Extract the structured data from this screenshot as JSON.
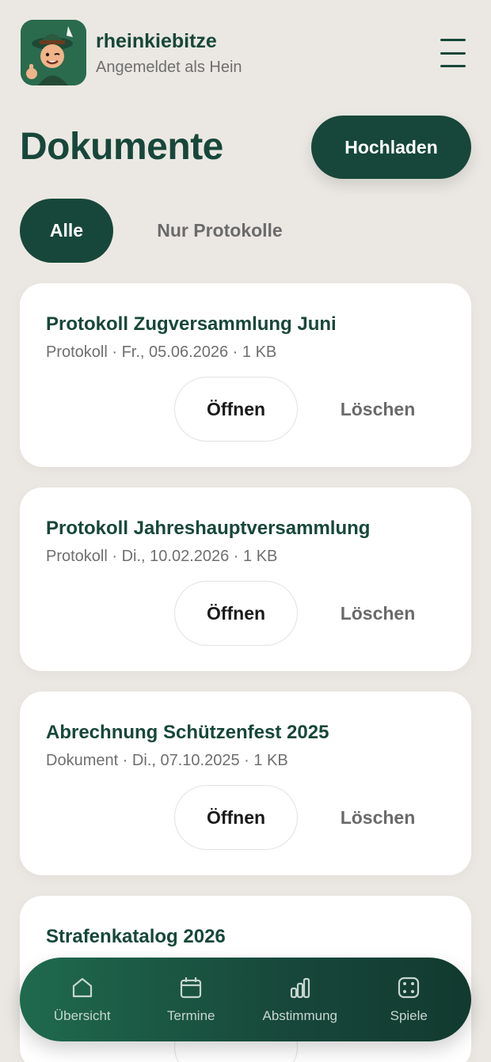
{
  "header": {
    "app_name": "rheinkiebitze",
    "subtitle": "Angemeldet als Hein"
  },
  "page": {
    "title": "Dokumente",
    "upload_label": "Hochladen"
  },
  "filters": [
    {
      "label": "Alle",
      "active": true
    },
    {
      "label": "Nur Protokolle",
      "active": false
    }
  ],
  "documents": [
    {
      "title": "Protokoll Zugversammlung Juni",
      "meta": "Protokoll · Fr., 05.06.2026 · 1 KB",
      "open_label": "Öffnen",
      "delete_label": "Löschen"
    },
    {
      "title": "Protokoll Jahreshauptversammlung",
      "meta": "Protokoll · Di., 10.02.2026 · 1 KB",
      "open_label": "Öffnen",
      "delete_label": "Löschen"
    },
    {
      "title": "Abrechnung Schützenfest 2025",
      "meta": "Dokument · Di., 07.10.2025 · 1 KB",
      "open_label": "Öffnen",
      "delete_label": "Löschen"
    },
    {
      "title": "Strafenkatalog 2026",
      "meta": "",
      "open_label": "",
      "delete_label": ""
    }
  ],
  "nav": [
    {
      "label": "Übersicht",
      "icon": "home-icon"
    },
    {
      "label": "Termine",
      "icon": "calendar-icon"
    },
    {
      "label": "Abstimmung",
      "icon": "bar-chart-icon"
    },
    {
      "label": "Spiele",
      "icon": "dice-icon"
    }
  ],
  "colors": {
    "primary": "#17473a",
    "background": "#ebe8e3",
    "card": "#ffffff",
    "muted_text": "#6f6f6f"
  }
}
